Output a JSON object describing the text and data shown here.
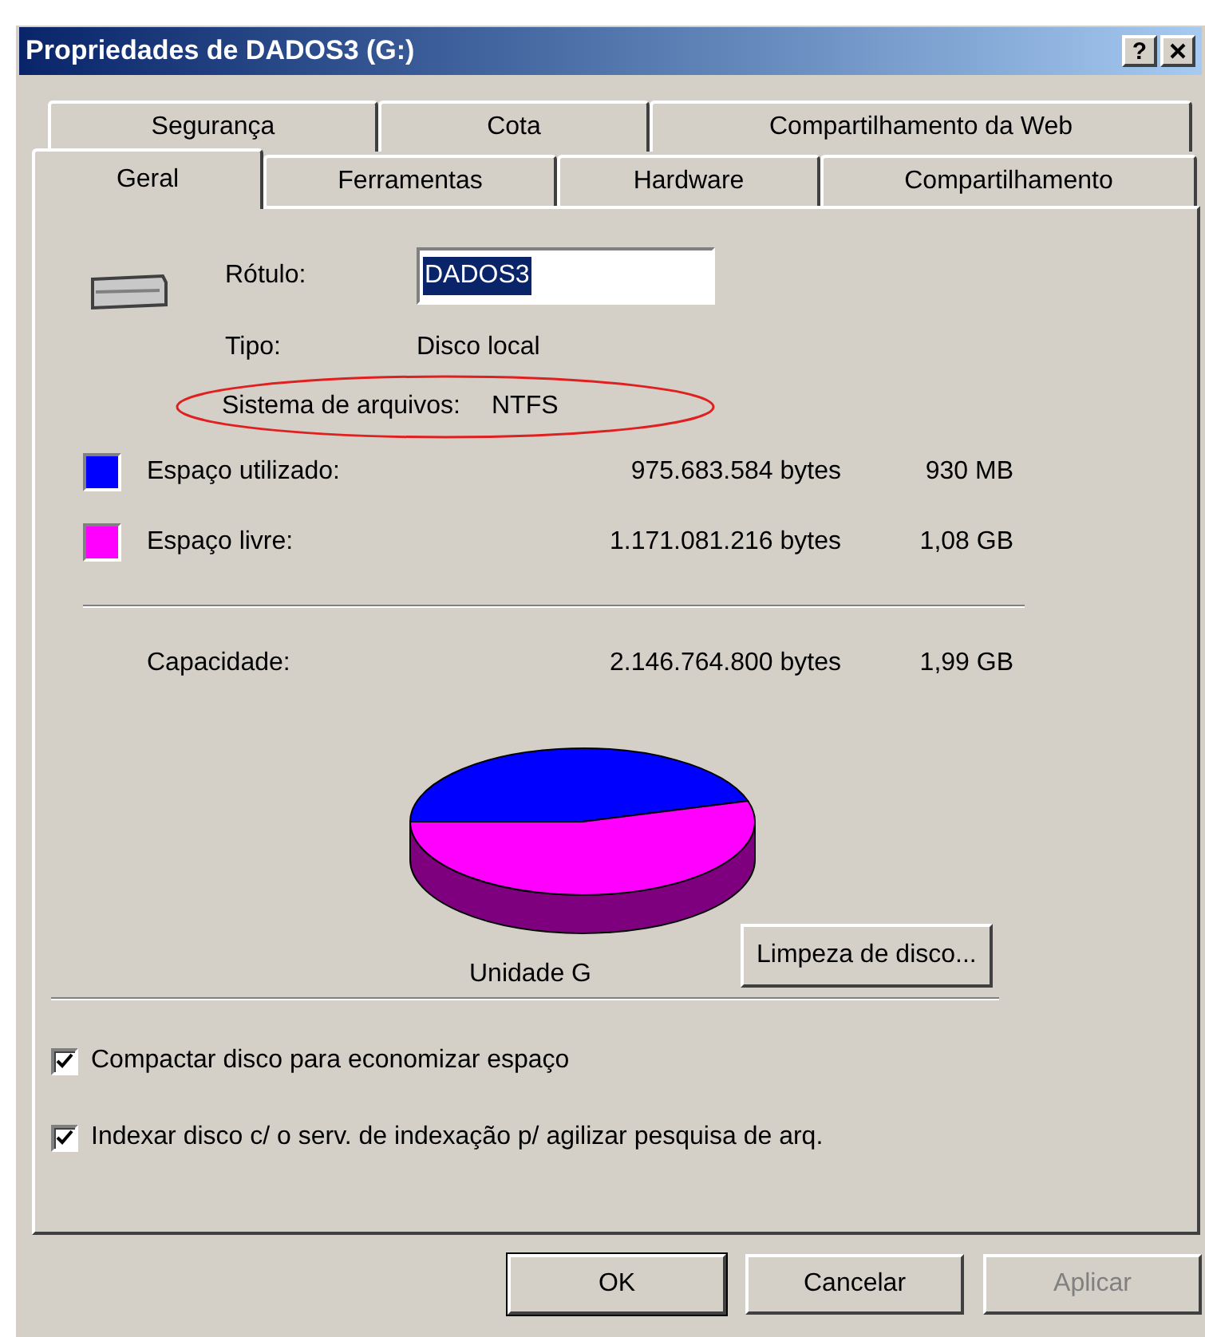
{
  "window": {
    "title": "Propriedades de DADOS3 (G:)",
    "help_button": "?"
  },
  "tab_rows": [
    [
      {
        "label": "Segurança",
        "selected": false
      },
      {
        "label": "Cota",
        "selected": false
      },
      {
        "label": "Compartilhamento da Web",
        "selected": false
      }
    ],
    [
      {
        "label": "Geral",
        "selected": true
      },
      {
        "label": "Ferramentas",
        "selected": false
      },
      {
        "label": "Hardware",
        "selected": false
      },
      {
        "label": "Compartilhamento",
        "selected": false
      }
    ]
  ],
  "label_field": {
    "label": "Rótulo:",
    "value": "DADOS3"
  },
  "type": {
    "label": "Tipo:",
    "value": "Disco local"
  },
  "file_system": {
    "label": "Sistema de arquivos:",
    "value": "NTFS"
  },
  "space": [
    {
      "label": "Espaço utilizado:",
      "bytes": "975.683.584 bytes",
      "size": "930 MB",
      "color": "#0000ff"
    },
    {
      "label": "Espaço livre:",
      "bytes": "1.171.081.216 bytes",
      "size": "1,08 GB",
      "color": "#ff00ff"
    }
  ],
  "capacity": {
    "label": "Capacidade:",
    "bytes": "2.146.764.800 bytes",
    "size": "1,99 GB"
  },
  "usage_pie": {
    "level": 0.4545
  },
  "drive_caption": "Unidade G",
  "cleanup_button": "Limpeza de disco...",
  "options": [
    {
      "label": "Compactar disco para economizar espaço",
      "checked": true
    },
    {
      "label": "Indexar disco c/ o serv. de indexação p/ agilizar pesquisa de arq.",
      "checked": true
    }
  ],
  "buttons": [
    {
      "label": "OK",
      "disabled": false
    },
    {
      "label": "Cancelar",
      "disabled": false
    },
    {
      "label": "Aplicar",
      "disabled": true
    }
  ]
}
